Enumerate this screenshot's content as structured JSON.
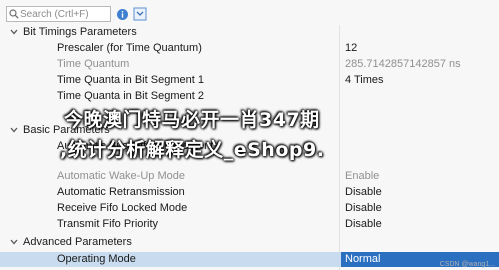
{
  "search": {
    "placeholder": "Search (Crtl+F)"
  },
  "toolbar": {
    "icons": [
      "info-icon",
      "expand-icon"
    ]
  },
  "sections": {
    "bit_timings": {
      "label": "Bit Timings Parameters",
      "rows": [
        {
          "name": "Prescaler (for Time Quantum)",
          "value": "12"
        },
        {
          "name": "Time Quantum",
          "value": "285.7142857142857 ns"
        },
        {
          "name": "Time Quanta in Bit Segment 1",
          "value": "4 Times"
        },
        {
          "name": "Time Quanta in Bit Segment 2",
          "value": ""
        },
        {
          "name": "",
          "value": ""
        }
      ]
    },
    "basic": {
      "label": "Basic Parameters",
      "rows": [
        {
          "name": "Automatic Bus-Off Management",
          "value": ""
        },
        {
          "name": "Automatic Wake-Up Mode",
          "value": "Enable"
        },
        {
          "name": "Automatic Retransmission",
          "value": "Disable"
        },
        {
          "name": "Receive Fifo Locked Mode",
          "value": "Disable"
        },
        {
          "name": "Transmit Fifo Priority",
          "value": "Disable"
        }
      ]
    },
    "advanced": {
      "label": "Advanced Parameters",
      "rows": [
        {
          "name": "Operating Mode",
          "value": "Normal"
        }
      ]
    }
  },
  "overlay": {
    "line1": "今晚澳门特马必开一肖347期",
    "line2": ",统计分析解释定义_eShop9."
  },
  "watermark": "CSDN @wang1..."
}
